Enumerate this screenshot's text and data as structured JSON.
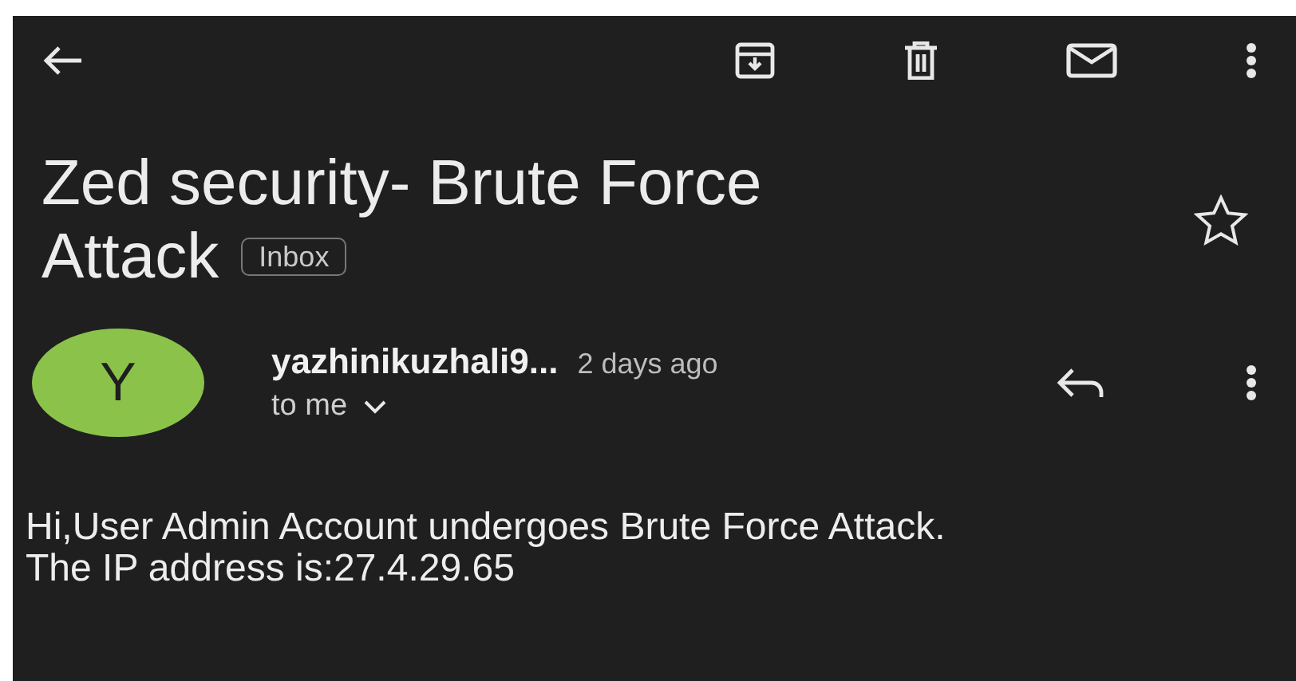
{
  "subject": {
    "title_lines": [
      "Zed security- Brute Force",
      "Attack"
    ],
    "label": "Inbox",
    "starred": false
  },
  "message": {
    "avatar_letter": "Y",
    "color": "#8bc34a",
    "sender": "yazhinikuzhali9...",
    "time": "2 days ago",
    "recipient": "to me",
    "body": "Hi,User Admin Account undergoes Brute Force Attack. The IP address is:27.4.29.65"
  }
}
